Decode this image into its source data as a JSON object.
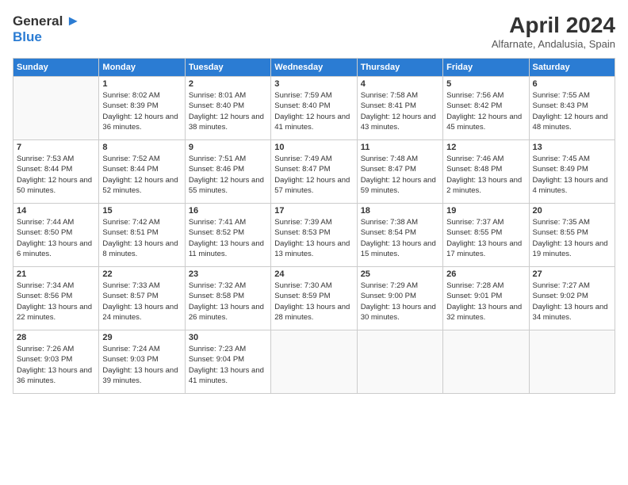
{
  "logo": {
    "line1": "General",
    "line2": "Blue",
    "icon": "▶"
  },
  "header": {
    "title": "April 2024",
    "location": "Alfarnate, Andalusia, Spain"
  },
  "days_of_week": [
    "Sunday",
    "Monday",
    "Tuesday",
    "Wednesday",
    "Thursday",
    "Friday",
    "Saturday"
  ],
  "weeks": [
    [
      {
        "num": "",
        "sunrise": "",
        "sunset": "",
        "daylight": ""
      },
      {
        "num": "1",
        "sunrise": "Sunrise: 8:02 AM",
        "sunset": "Sunset: 8:39 PM",
        "daylight": "Daylight: 12 hours and 36 minutes."
      },
      {
        "num": "2",
        "sunrise": "Sunrise: 8:01 AM",
        "sunset": "Sunset: 8:40 PM",
        "daylight": "Daylight: 12 hours and 38 minutes."
      },
      {
        "num": "3",
        "sunrise": "Sunrise: 7:59 AM",
        "sunset": "Sunset: 8:40 PM",
        "daylight": "Daylight: 12 hours and 41 minutes."
      },
      {
        "num": "4",
        "sunrise": "Sunrise: 7:58 AM",
        "sunset": "Sunset: 8:41 PM",
        "daylight": "Daylight: 12 hours and 43 minutes."
      },
      {
        "num": "5",
        "sunrise": "Sunrise: 7:56 AM",
        "sunset": "Sunset: 8:42 PM",
        "daylight": "Daylight: 12 hours and 45 minutes."
      },
      {
        "num": "6",
        "sunrise": "Sunrise: 7:55 AM",
        "sunset": "Sunset: 8:43 PM",
        "daylight": "Daylight: 12 hours and 48 minutes."
      }
    ],
    [
      {
        "num": "7",
        "sunrise": "Sunrise: 7:53 AM",
        "sunset": "Sunset: 8:44 PM",
        "daylight": "Daylight: 12 hours and 50 minutes."
      },
      {
        "num": "8",
        "sunrise": "Sunrise: 7:52 AM",
        "sunset": "Sunset: 8:44 PM",
        "daylight": "Daylight: 12 hours and 52 minutes."
      },
      {
        "num": "9",
        "sunrise": "Sunrise: 7:51 AM",
        "sunset": "Sunset: 8:46 PM",
        "daylight": "Daylight: 12 hours and 55 minutes."
      },
      {
        "num": "10",
        "sunrise": "Sunrise: 7:49 AM",
        "sunset": "Sunset: 8:47 PM",
        "daylight": "Daylight: 12 hours and 57 minutes."
      },
      {
        "num": "11",
        "sunrise": "Sunrise: 7:48 AM",
        "sunset": "Sunset: 8:47 PM",
        "daylight": "Daylight: 12 hours and 59 minutes."
      },
      {
        "num": "12",
        "sunrise": "Sunrise: 7:46 AM",
        "sunset": "Sunset: 8:48 PM",
        "daylight": "Daylight: 13 hours and 2 minutes."
      },
      {
        "num": "13",
        "sunrise": "Sunrise: 7:45 AM",
        "sunset": "Sunset: 8:49 PM",
        "daylight": "Daylight: 13 hours and 4 minutes."
      }
    ],
    [
      {
        "num": "14",
        "sunrise": "Sunrise: 7:44 AM",
        "sunset": "Sunset: 8:50 PM",
        "daylight": "Daylight: 13 hours and 6 minutes."
      },
      {
        "num": "15",
        "sunrise": "Sunrise: 7:42 AM",
        "sunset": "Sunset: 8:51 PM",
        "daylight": "Daylight: 13 hours and 8 minutes."
      },
      {
        "num": "16",
        "sunrise": "Sunrise: 7:41 AM",
        "sunset": "Sunset: 8:52 PM",
        "daylight": "Daylight: 13 hours and 11 minutes."
      },
      {
        "num": "17",
        "sunrise": "Sunrise: 7:39 AM",
        "sunset": "Sunset: 8:53 PM",
        "daylight": "Daylight: 13 hours and 13 minutes."
      },
      {
        "num": "18",
        "sunrise": "Sunrise: 7:38 AM",
        "sunset": "Sunset: 8:54 PM",
        "daylight": "Daylight: 13 hours and 15 minutes."
      },
      {
        "num": "19",
        "sunrise": "Sunrise: 7:37 AM",
        "sunset": "Sunset: 8:55 PM",
        "daylight": "Daylight: 13 hours and 17 minutes."
      },
      {
        "num": "20",
        "sunrise": "Sunrise: 7:35 AM",
        "sunset": "Sunset: 8:55 PM",
        "daylight": "Daylight: 13 hours and 19 minutes."
      }
    ],
    [
      {
        "num": "21",
        "sunrise": "Sunrise: 7:34 AM",
        "sunset": "Sunset: 8:56 PM",
        "daylight": "Daylight: 13 hours and 22 minutes."
      },
      {
        "num": "22",
        "sunrise": "Sunrise: 7:33 AM",
        "sunset": "Sunset: 8:57 PM",
        "daylight": "Daylight: 13 hours and 24 minutes."
      },
      {
        "num": "23",
        "sunrise": "Sunrise: 7:32 AM",
        "sunset": "Sunset: 8:58 PM",
        "daylight": "Daylight: 13 hours and 26 minutes."
      },
      {
        "num": "24",
        "sunrise": "Sunrise: 7:30 AM",
        "sunset": "Sunset: 8:59 PM",
        "daylight": "Daylight: 13 hours and 28 minutes."
      },
      {
        "num": "25",
        "sunrise": "Sunrise: 7:29 AM",
        "sunset": "Sunset: 9:00 PM",
        "daylight": "Daylight: 13 hours and 30 minutes."
      },
      {
        "num": "26",
        "sunrise": "Sunrise: 7:28 AM",
        "sunset": "Sunset: 9:01 PM",
        "daylight": "Daylight: 13 hours and 32 minutes."
      },
      {
        "num": "27",
        "sunrise": "Sunrise: 7:27 AM",
        "sunset": "Sunset: 9:02 PM",
        "daylight": "Daylight: 13 hours and 34 minutes."
      }
    ],
    [
      {
        "num": "28",
        "sunrise": "Sunrise: 7:26 AM",
        "sunset": "Sunset: 9:03 PM",
        "daylight": "Daylight: 13 hours and 36 minutes."
      },
      {
        "num": "29",
        "sunrise": "Sunrise: 7:24 AM",
        "sunset": "Sunset: 9:03 PM",
        "daylight": "Daylight: 13 hours and 39 minutes."
      },
      {
        "num": "30",
        "sunrise": "Sunrise: 7:23 AM",
        "sunset": "Sunset: 9:04 PM",
        "daylight": "Daylight: 13 hours and 41 minutes."
      },
      {
        "num": "",
        "sunrise": "",
        "sunset": "",
        "daylight": ""
      },
      {
        "num": "",
        "sunrise": "",
        "sunset": "",
        "daylight": ""
      },
      {
        "num": "",
        "sunrise": "",
        "sunset": "",
        "daylight": ""
      },
      {
        "num": "",
        "sunrise": "",
        "sunset": "",
        "daylight": ""
      }
    ]
  ]
}
